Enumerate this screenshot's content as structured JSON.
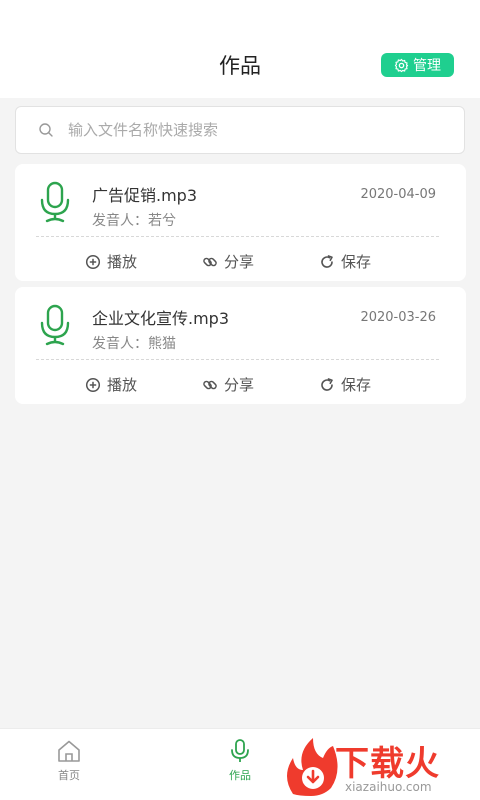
{
  "header": {
    "title": "作品",
    "manage_label": "管理"
  },
  "search": {
    "placeholder": "输入文件名称快速搜索"
  },
  "works": [
    {
      "name": "广告促销.mp3",
      "date": "2020-04-09",
      "speaker": "发音人：若兮"
    },
    {
      "name": "企业文化宣传.mp3",
      "date": "2020-03-26",
      "speaker": "发音人：熊猫"
    }
  ],
  "actions": {
    "play": "播放",
    "share": "分享",
    "save": "保存"
  },
  "tabbar": {
    "home": "首页",
    "works": "作品"
  },
  "watermark": {
    "text": "下载火",
    "url": "xiazaihuo.com"
  },
  "colors": {
    "accent": "#1fcf8f",
    "mic_green": "#2da44e",
    "watermark_red": "#ef3b2d"
  }
}
